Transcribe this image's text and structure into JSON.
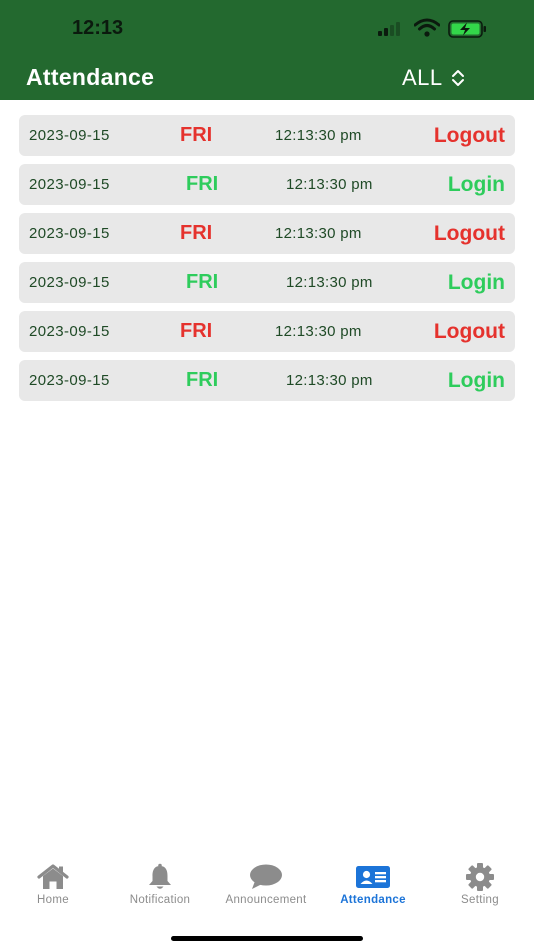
{
  "status_bar": {
    "time": "12:13"
  },
  "header": {
    "title": "Attendance",
    "filter_label": "ALL"
  },
  "colors": {
    "header_bg": "#23692f",
    "logout": "#e5322d",
    "login": "#2ecc5c",
    "active_tab": "#1c74d8",
    "inactive_tab": "#8c8c8c"
  },
  "records": [
    {
      "date": "2023-09-15",
      "day": "FRI",
      "time": "12:13:30 pm",
      "action": "Logout"
    },
    {
      "date": "2023-09-15",
      "day": "FRI",
      "time": "12:13:30 pm",
      "action": "Login"
    },
    {
      "date": "2023-09-15",
      "day": "FRI",
      "time": "12:13:30 pm",
      "action": "Logout"
    },
    {
      "date": "2023-09-15",
      "day": "FRI",
      "time": "12:13:30 pm",
      "action": "Login"
    },
    {
      "date": "2023-09-15",
      "day": "FRI",
      "time": "12:13:30 pm",
      "action": "Logout"
    },
    {
      "date": "2023-09-15",
      "day": "FRI",
      "time": "12:13:30 pm",
      "action": "Login"
    }
  ],
  "tabbar": {
    "tabs": [
      {
        "label": "Home",
        "icon": "home-icon"
      },
      {
        "label": "Notification",
        "icon": "bell-icon"
      },
      {
        "label": "Announcement",
        "icon": "chat-bubble-icon"
      },
      {
        "label": "Attendance",
        "icon": "id-card-icon",
        "active": true
      },
      {
        "label": "Setting",
        "icon": "gear-icon"
      }
    ]
  }
}
